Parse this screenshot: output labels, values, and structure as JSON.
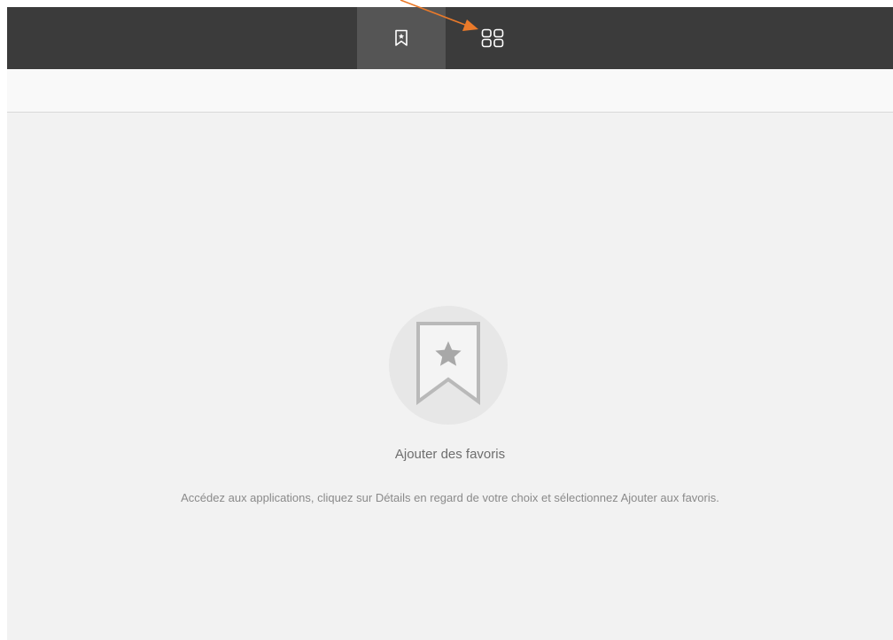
{
  "topbar": {
    "tabs": [
      {
        "icon": "bookmark-star-icon",
        "selected": true
      },
      {
        "icon": "grid-icon",
        "selected": false
      }
    ]
  },
  "empty_state": {
    "icon": "bookmark-star-icon",
    "title": "Ajouter des favoris",
    "description": "Accédez aux applications, cliquez sur Détails en regard de votre choix et sélectionnez Ajouter aux favoris."
  },
  "annotation": {
    "type": "arrow",
    "color": "#ea7a2a",
    "points_to": "grid-icon"
  },
  "colors": {
    "topbar": "#3b3b3b",
    "selected_tab": "#555555",
    "content_bg": "#f2f2f2",
    "accent_annotation": "#ea7a2a"
  }
}
